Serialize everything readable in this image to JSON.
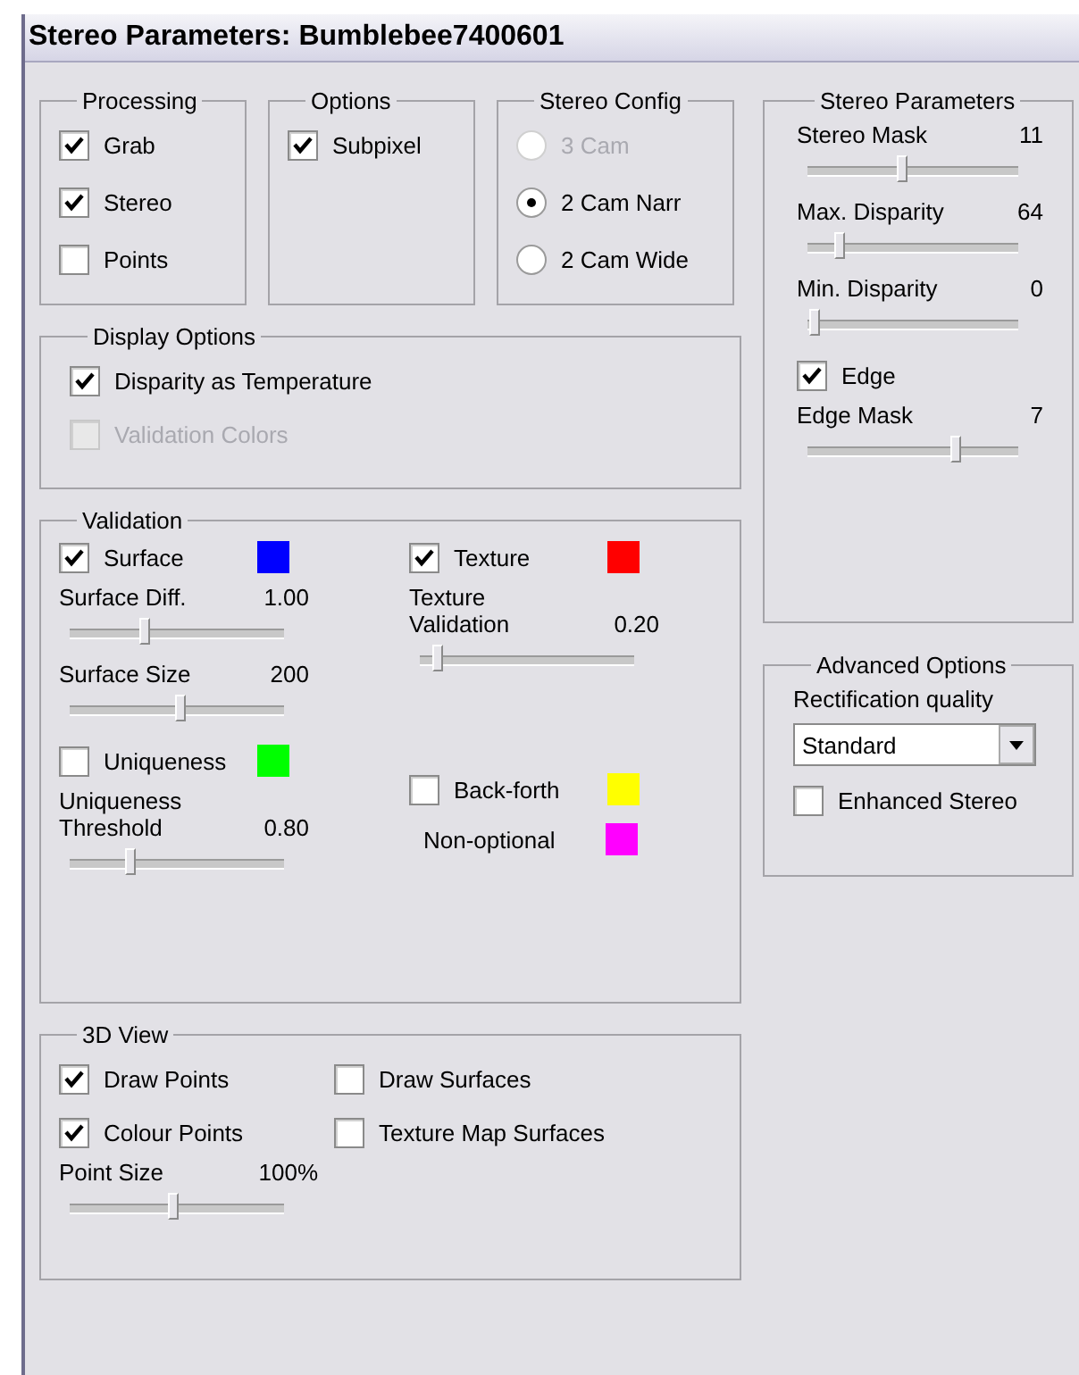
{
  "window": {
    "title": "Stereo Parameters: Bumblebee7400601"
  },
  "processing": {
    "title": "Processing",
    "items": [
      {
        "label": "Grab",
        "checked": true
      },
      {
        "label": "Stereo",
        "checked": true
      },
      {
        "label": "Points",
        "checked": false
      }
    ]
  },
  "options": {
    "title": "Options",
    "items": [
      {
        "label": "Subpixel",
        "checked": true
      }
    ]
  },
  "stereo_config": {
    "title": "Stereo Config",
    "options": [
      {
        "label": "3 Cam",
        "selected": false,
        "disabled": true
      },
      {
        "label": "2 Cam Narr",
        "selected": true,
        "disabled": false
      },
      {
        "label": "2 Cam Wide",
        "selected": false,
        "disabled": false
      }
    ]
  },
  "display_options": {
    "title": "Display Options",
    "items": [
      {
        "label": "Disparity as Temperature",
        "checked": true,
        "disabled": false
      },
      {
        "label": "Validation Colors",
        "checked": false,
        "disabled": true
      }
    ]
  },
  "validation": {
    "title": "Validation",
    "columns": [
      [
        {
          "kind": "check",
          "label": "Surface",
          "checked": true,
          "color": "#0000ff"
        },
        {
          "kind": "slider",
          "label": "Surface Diff.",
          "value": "1.00",
          "level": 0.35
        },
        {
          "kind": "slider",
          "label": "Surface Size",
          "value": "200",
          "level": 0.52
        },
        {
          "kind": "check",
          "label": "Uniqueness",
          "checked": false,
          "color": "#00ff00"
        },
        {
          "kind": "slider",
          "label": "Uniqueness Threshold",
          "value": "0.80",
          "level": 0.28
        }
      ],
      [
        {
          "kind": "check",
          "label": "Texture",
          "checked": true,
          "color": "#ff0000"
        },
        {
          "kind": "slider",
          "label": "Texture Validation",
          "value": "0.20",
          "level": 0.08
        },
        {
          "kind": "spacer"
        },
        {
          "kind": "check",
          "label": "Back-forth",
          "checked": false,
          "color": "#ffff00"
        },
        {
          "kind": "swatch",
          "label": "Non-optional",
          "color": "#ff00ff"
        }
      ]
    ]
  },
  "view_3d": {
    "title": "3D View",
    "items": [
      {
        "label": "Draw Points",
        "checked": true
      },
      {
        "label": "Draw Surfaces",
        "checked": false
      },
      {
        "label": "Colour Points",
        "checked": true
      },
      {
        "label": "Texture Map Surfaces",
        "checked": false
      }
    ],
    "point_size": {
      "label": "Point Size",
      "value": "100%",
      "level": 0.48
    }
  },
  "stereo_parameters": {
    "title": "Stereo Parameters",
    "items": [
      {
        "kind": "slider",
        "label": "Stereo Mask",
        "value": "11",
        "level": 0.45
      },
      {
        "kind": "slider",
        "label": "Max. Disparity",
        "value": "64",
        "level": 0.15
      },
      {
        "kind": "slider",
        "label": "Min. Disparity",
        "value": "0",
        "level": 0.03
      },
      {
        "kind": "check",
        "label": "Edge",
        "checked": true
      },
      {
        "kind": "slider",
        "label": "Edge Mask",
        "value": "7",
        "level": 0.7
      }
    ]
  },
  "advanced_options": {
    "title": "Advanced Options",
    "label": "Rectification quality",
    "select": "Standard",
    "enhanced": {
      "label": "Enhanced Stereo",
      "checked": false
    }
  }
}
